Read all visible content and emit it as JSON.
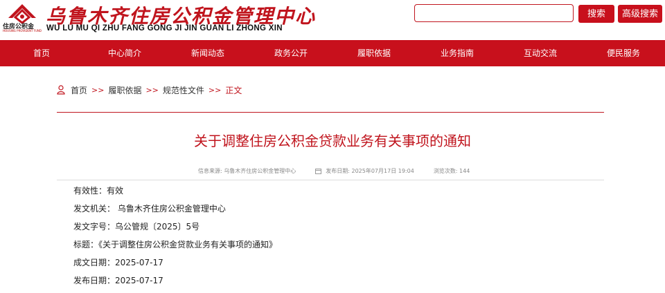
{
  "header": {
    "title_cn": "乌鲁木齐住房公积金管理中心",
    "title_en": "WU LU MU QI ZHU FANG GONG JI JIN GUAN LI ZHONG XIN",
    "logo_caption": "住房公积金",
    "logo_caption_en": "HOUSING PROVIDENT FUND",
    "search_value": "",
    "search_button": "搜索",
    "advanced_button": "高级搜索",
    "brand_color": "#c8101c"
  },
  "nav": {
    "items": [
      "首页",
      "中心简介",
      "新闻动态",
      "政务公开",
      "履职依据",
      "业务指南",
      "互动交流",
      "便民服务"
    ]
  },
  "breadcrumb": {
    "items": [
      "首页",
      "履职依据",
      "规范性文件"
    ],
    "separator": ">>",
    "current": "正文"
  },
  "article": {
    "title": "关于调整住房公积金贷款业务有关事项的通知",
    "source": "信息来源:  乌鲁木齐住房公积金管理中心",
    "publish_date": "发布日期:  2025年07月17日 19:04",
    "views": "浏览次数:  144",
    "fields": [
      "有效性：有效",
      "发文机关：  乌鲁木齐住房公积金管理中心",
      "发文字号：乌公管规〔2025〕5号",
      "标题：《关于调整住房公积金贷款业务有关事项的通知》",
      "成文日期：2025-07-17",
      "发布日期：2025-07-17"
    ]
  }
}
